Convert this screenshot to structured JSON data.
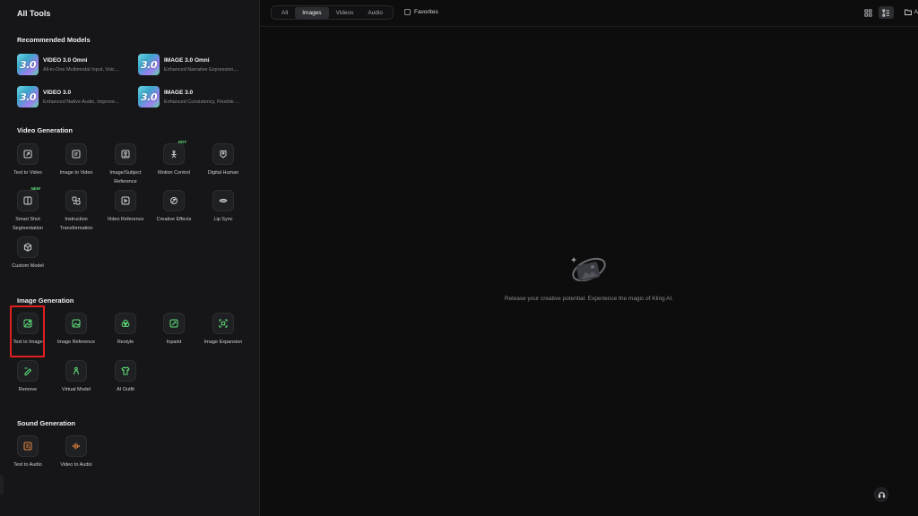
{
  "sidebar": {
    "title": "All Tools",
    "recommended": {
      "title": "Recommended Models",
      "models": [
        {
          "badge": "3.0",
          "name": "VIDEO 3.0 Omni",
          "desc": "All-in-One Multimodal Input, Voic..."
        },
        {
          "badge": "3.0",
          "name": "IMAGE 3.0 Omni",
          "desc": "Enhanced Narrative Expression,..."
        },
        {
          "badge": "3.0",
          "name": "VIDEO 3.0",
          "desc": "Enhanced Native Audio, Improve..."
        },
        {
          "badge": "3.0",
          "name": "IMAGE 3.0",
          "desc": "Enhanced Consistency, Flexible ..."
        }
      ]
    },
    "video": {
      "title": "Video Generation",
      "tools": [
        {
          "label": "Text to Video",
          "icon": "text-video-icon"
        },
        {
          "label": "Image to Video",
          "icon": "image-video-icon"
        },
        {
          "label": "Image/Subject Reference",
          "icon": "subject-reference-icon"
        },
        {
          "label": "Motion Control",
          "icon": "motion-control-icon",
          "badge": "HOT"
        },
        {
          "label": "Digital Human",
          "icon": "digital-human-icon"
        },
        {
          "label": "Smart Shot Segmentation",
          "icon": "smart-shot-icon",
          "badge": "NEW"
        },
        {
          "label": "Instruction Transformation",
          "icon": "instruction-icon"
        },
        {
          "label": "Video Reference",
          "icon": "video-reference-icon"
        },
        {
          "label": "Creative Effects",
          "icon": "creative-effects-icon"
        },
        {
          "label": "Lip Sync",
          "icon": "lip-sync-icon"
        },
        {
          "label": "Custom Model",
          "icon": "custom-model-icon"
        }
      ]
    },
    "image": {
      "title": "Image Generation",
      "tools": [
        {
          "label": "Text to Image",
          "icon": "text-image-icon"
        },
        {
          "label": "Image Reference",
          "icon": "image-reference-icon"
        },
        {
          "label": "Restyle",
          "icon": "restyle-icon"
        },
        {
          "label": "Inpaint",
          "icon": "inpaint-icon"
        },
        {
          "label": "Image Expansion",
          "icon": "image-expansion-icon"
        },
        {
          "label": "Remove",
          "icon": "remove-icon"
        },
        {
          "label": "Virtual Model",
          "icon": "virtual-model-icon"
        },
        {
          "label": "AI Outfit",
          "icon": "ai-outfit-icon"
        }
      ]
    },
    "sound": {
      "title": "Sound Generation",
      "tools": [
        {
          "label": "Text to Audio",
          "icon": "text-audio-icon"
        },
        {
          "label": "Video to Audio",
          "icon": "video-audio-icon"
        }
      ]
    }
  },
  "topbar": {
    "tabs": [
      "All",
      "Images",
      "Videos",
      "Audio"
    ],
    "active_tab": "Images",
    "favorites_label": "Favorites",
    "right_cut_label": "A"
  },
  "main": {
    "empty_message": "Release your creative potential. Experience the magic of Kling AI."
  },
  "colors": {
    "accent_green": "#5fe27a",
    "accent_orange": "#f08a3c",
    "highlight_red": "#e0201f"
  }
}
